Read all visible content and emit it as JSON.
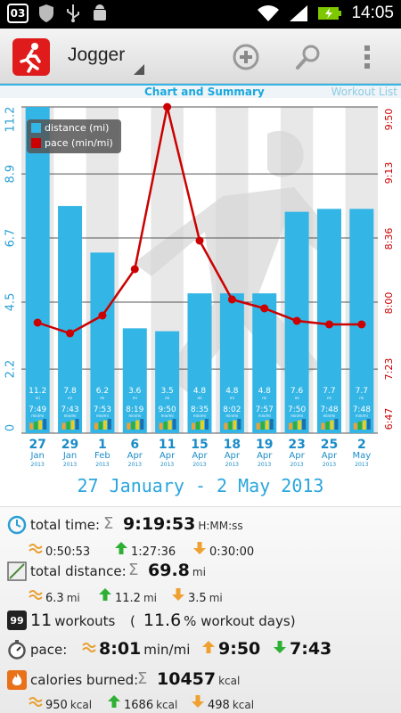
{
  "status_bar": {
    "badge": "03",
    "time": "14:05"
  },
  "app": {
    "title": "Jogger"
  },
  "tabs": {
    "active": "Chart and Summary",
    "other": "Workout List"
  },
  "chart_data": {
    "type": "bar",
    "legend": [
      "distance (mi)",
      "pace (min/mi)"
    ],
    "categories": [
      {
        "day": "27",
        "month": "Jan",
        "year": "2013"
      },
      {
        "day": "29",
        "month": "Jan",
        "year": "2013"
      },
      {
        "day": "1",
        "month": "Feb",
        "year": "2013"
      },
      {
        "day": "6",
        "month": "Apr",
        "year": "2013"
      },
      {
        "day": "11",
        "month": "Apr",
        "year": "2013"
      },
      {
        "day": "15",
        "month": "Apr",
        "year": "2013"
      },
      {
        "day": "18",
        "month": "Apr",
        "year": "2013"
      },
      {
        "day": "19",
        "month": "Apr",
        "year": "2013"
      },
      {
        "day": "23",
        "month": "Apr",
        "year": "2013"
      },
      {
        "day": "25",
        "month": "Apr",
        "year": "2013"
      },
      {
        "day": "2",
        "month": "May",
        "year": "2013"
      }
    ],
    "distance": [
      11.2,
      7.8,
      6.2,
      3.6,
      3.5,
      4.8,
      4.8,
      4.8,
      7.6,
      7.7,
      7.7
    ],
    "distance_labels": [
      "11.2",
      "7.8",
      "6.2",
      "3.6",
      "3.5",
      "4.8",
      "4.8",
      "4.8",
      "7.6",
      "7.7",
      "7.7"
    ],
    "pace_labels": [
      "7:49",
      "7:43",
      "7:53",
      "8:19",
      "9:50",
      "8:35",
      "8:02",
      "7:57",
      "7:50",
      "7:48",
      "7:48"
    ],
    "pace_seconds": [
      469,
      463,
      473,
      499,
      590,
      515,
      482,
      477,
      470,
      468,
      468
    ],
    "bar_sub_unit_mi": "mi",
    "bar_sub_unit_pace": "min/mi",
    "left_axis": {
      "ticks": [
        "0",
        "2.2",
        "4.5",
        "6.7",
        "8.9",
        "11.2"
      ],
      "values": [
        0,
        2.2,
        4.5,
        6.7,
        8.9,
        11.2
      ],
      "range": [
        0,
        11.2
      ]
    },
    "right_axis": {
      "ticks": [
        "6:47",
        "7:23",
        "8:00",
        "8:36",
        "9:13",
        "9:50"
      ],
      "values": [
        407,
        443,
        480,
        516,
        553,
        590
      ],
      "range": [
        407,
        590
      ]
    },
    "colors": {
      "bar": "#33b5e5",
      "line": "#cc0000",
      "left_axis": "#2a9fd6",
      "right_axis": "#cc0000"
    }
  },
  "date_range": "27 January - 2 May 2013",
  "summary": {
    "total_time": {
      "label": "total time:",
      "value": "9:19:53",
      "unit": "H:MM:ss",
      "avg": "0:50:53",
      "max": "1:27:36",
      "min": "0:30:00"
    },
    "total_distance": {
      "label": "total distance:",
      "value": "69.8",
      "unit": "mi",
      "avg": "6.3",
      "max": "11.2",
      "min": "3.5",
      "sub_unit": "mi"
    },
    "workouts": {
      "icon_text": "99",
      "count": "11",
      "count_label": "workouts",
      "pct_open": "(",
      "pct": "11.6",
      "pct_label": "% workout days)"
    },
    "pace": {
      "label": "pace:",
      "avg": "8:01",
      "unit": "min/mi",
      "max": "9:50",
      "min": "7:43"
    },
    "calories": {
      "label": "calories burned:",
      "value": "10457",
      "unit": "kcal",
      "avg": "950",
      "max": "1686",
      "min": "498",
      "sub_unit": "kcal"
    }
  }
}
